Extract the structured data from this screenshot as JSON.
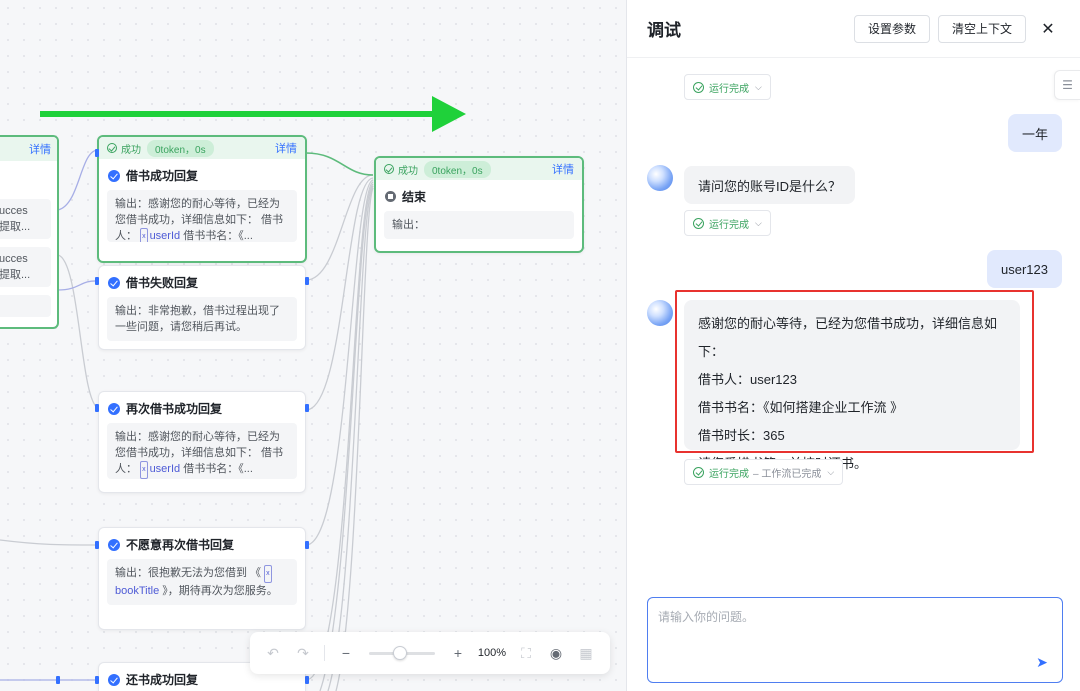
{
  "canvas": {
    "nodes": {
      "partial_a": {
        "detail": "详情",
        "row1_a": "ucces",
        "row1_b": "提取...",
        "row2_a": "ucces",
        "row2_b": "提取..."
      },
      "borrow_success": {
        "status": "成功",
        "token": "0token，0s",
        "detail": "详情",
        "title": "借书成功回复",
        "out_prefix": "输出：感谢您的耐心等待，已经为您借书成功，详细信息如下： 借书人：",
        "var": "userId",
        "out_suffix": "借书书名：《..."
      },
      "borrow_fail": {
        "title": "借书失败回复",
        "output": "输出：非常抱歉，借书过程出现了一些问题，请您稍后再试。"
      },
      "end": {
        "status": "成功",
        "token": "0token，0s",
        "detail": "详情",
        "title": "结束",
        "output": "输出："
      },
      "reborrow_success": {
        "title": "再次借书成功回复",
        "out_prefix": "输出：感谢您的耐心等待，已经为您借书成功，详细信息如下： 借书人：",
        "var": "userId",
        "out_suffix": "借书书名：《..."
      },
      "unwilling": {
        "title": "不愿意再次借书回复",
        "out_prefix": "输出：很抱歉无法为您借到 《",
        "var": "bookTitle",
        "out_suffix": "》，期待再次为您服务。"
      },
      "return_success": {
        "title": "还书成功回复"
      }
    },
    "toolbar": {
      "zoom": "100%"
    },
    "arrow_color": "#1fd13a"
  },
  "panel": {
    "title": "调试",
    "btn_params": "设置参数",
    "btn_clear": "清空上下文",
    "run_done": "运行完成",
    "workflow_done": "– 工作流已完成",
    "messages": {
      "user_1": "一年",
      "bot_1": "请问您的账号ID是什么？",
      "user_2": "user123",
      "answer": [
        "感谢您的耐心等待，已经为您借书成功，详细信息如下：",
        "借书人：user123",
        "借书书名：《如何搭建企业工作流 》",
        "借书时长：365",
        "请您爱惜书籍，并按时还书。"
      ]
    },
    "input_placeholder": "请输入你的问题。",
    "highlight_color": "#e8322f"
  }
}
